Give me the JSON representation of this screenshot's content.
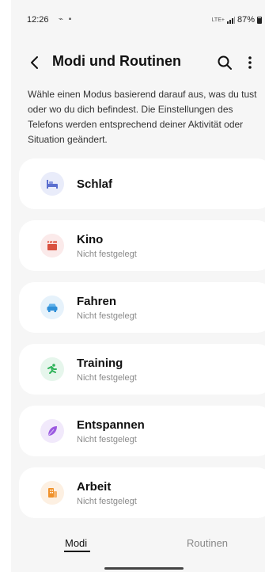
{
  "status_bar": {
    "time": "12:26",
    "notifications": "⌁ ▪",
    "network": "LTE+",
    "battery": "87%"
  },
  "header": {
    "title": "Modi und Routinen",
    "back_icon": "chevron-left-icon",
    "search_icon": "search-icon",
    "more_icon": "more-vertical-icon"
  },
  "description": "Wähle einen Modus basierend darauf aus, was du tust oder wo du dich befindest. Die Einstellungen des Telefons werden entsprechend deiner Aktivität oder Situation geändert.",
  "modes": [
    {
      "name": "Schlaf",
      "subtitle": "",
      "icon": "bed-icon",
      "icon_color": "#5b6fcf",
      "icon_bg": "#e9ecfa"
    },
    {
      "name": "Kino",
      "subtitle": "Nicht festgelegt",
      "icon": "clapperboard-icon",
      "icon_color": "#d9503f",
      "icon_bg": "#fbeaea"
    },
    {
      "name": "Fahren",
      "subtitle": "Nicht festgelegt",
      "icon": "car-icon",
      "icon_color": "#2f8fd8",
      "icon_bg": "#e6f2fb"
    },
    {
      "name": "Training",
      "subtitle": "Nicht festgelegt",
      "icon": "running-icon",
      "icon_color": "#2fb35a",
      "icon_bg": "#e6f6ec"
    },
    {
      "name": "Entspannen",
      "subtitle": "Nicht festgelegt",
      "icon": "leaf-icon",
      "icon_color": "#9b59e0",
      "icon_bg": "#f1e9fb"
    },
    {
      "name": "Arbeit",
      "subtitle": "Nicht festgelegt",
      "icon": "building-icon",
      "icon_color": "#f0922b",
      "icon_bg": "#fdf0e2"
    }
  ],
  "tabs": {
    "modi": "Modi",
    "routinen": "Routinen",
    "active": "Modi"
  }
}
